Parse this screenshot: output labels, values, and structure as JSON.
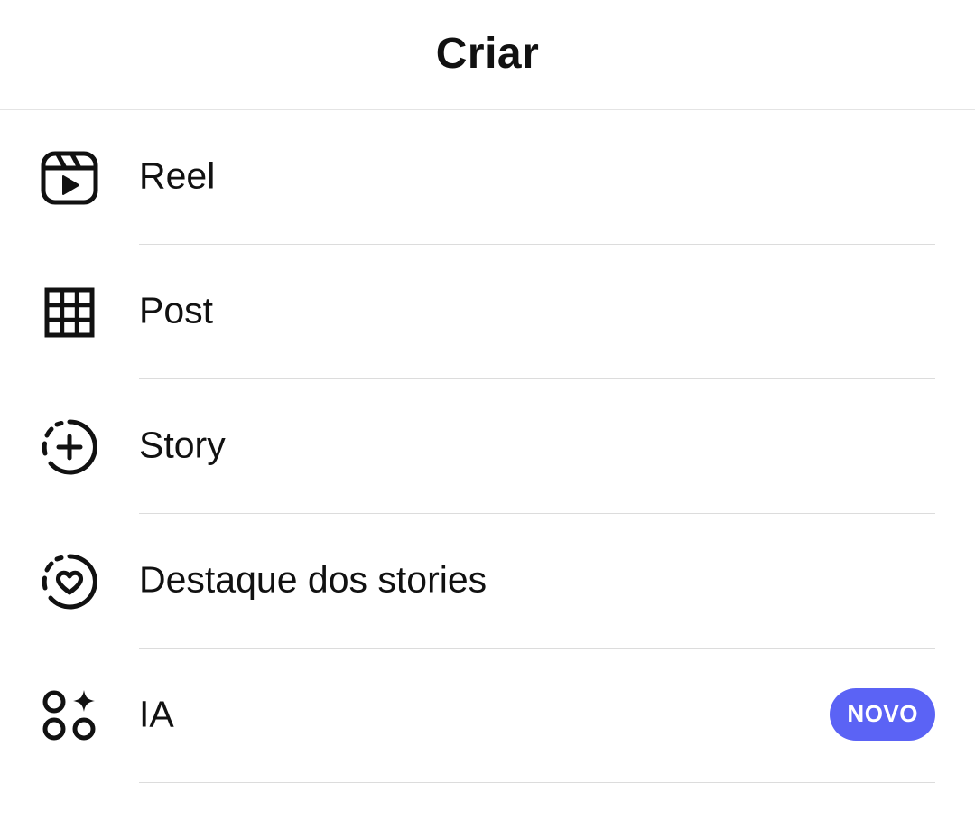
{
  "header": {
    "title": "Criar"
  },
  "menu": {
    "items": [
      {
        "label": "Reel",
        "icon": "reel-icon"
      },
      {
        "label": "Post",
        "icon": "grid-icon"
      },
      {
        "label": "Story",
        "icon": "story-add-icon"
      },
      {
        "label": "Destaque dos stories",
        "icon": "highlight-heart-icon"
      },
      {
        "label": "IA",
        "icon": "ai-sparkle-icon",
        "badge": "NOVO"
      }
    ]
  },
  "colors": {
    "badge_background": "#5b63f5",
    "text": "#111111",
    "divider": "#dcdcdc"
  }
}
